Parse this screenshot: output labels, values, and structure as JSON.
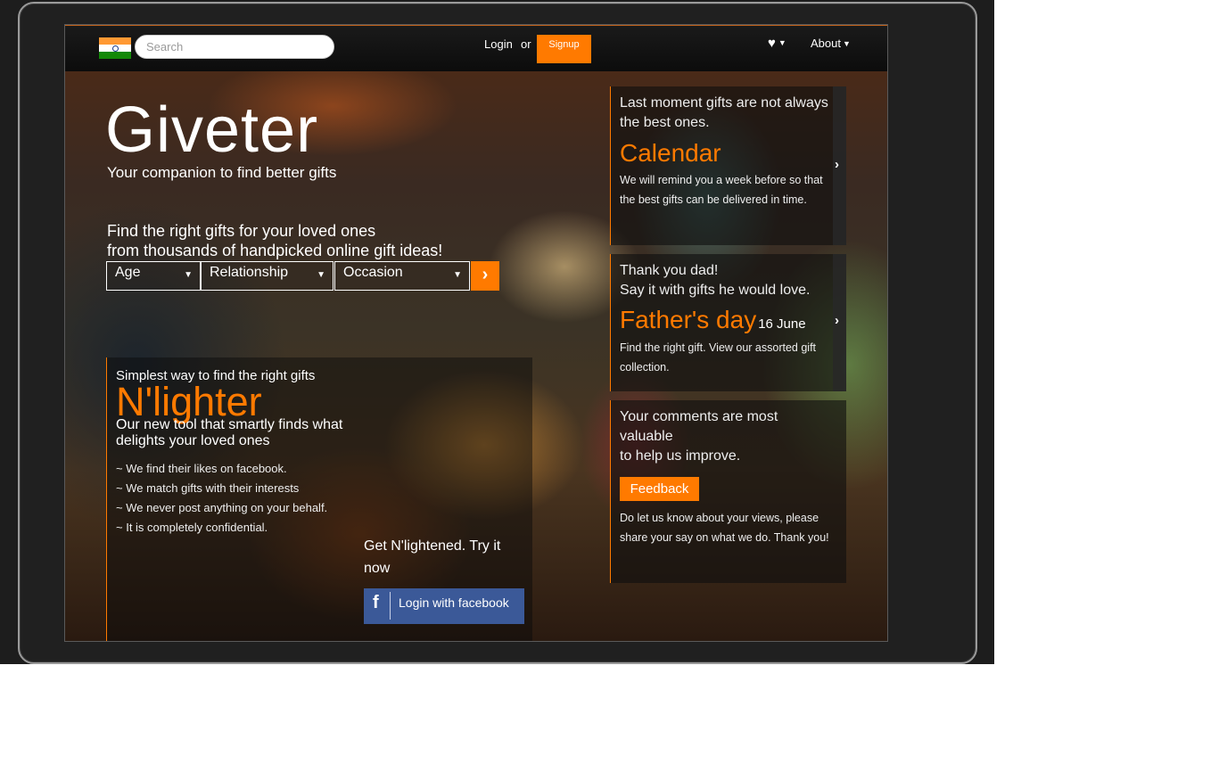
{
  "search": {
    "placeholder": "Search"
  },
  "nav": {
    "login_label": "Login",
    "or_label": "or",
    "signup_label": "Signup",
    "about_label": "About",
    "wishlist_icon": "heart-icon",
    "flag_icon": "india-flag-icon"
  },
  "hero": {
    "brand": "Giveter",
    "tagline": "Your companion to find better gifts",
    "find_line1": "Find the right gifts for your loved ones",
    "find_line2": "from thousands of handpicked online gift ideas!",
    "filters": [
      {
        "label": "Age"
      },
      {
        "label": "Relationship"
      },
      {
        "label": "Occasion"
      }
    ]
  },
  "nlighter": {
    "top": "Simplest way to find the right gifts",
    "title": "N'lighter",
    "desc": "Our new tool that smartly finds what delights your loved ones",
    "points": [
      "~ We find their likes on facebook.",
      "~ We match gifts with their interests",
      "~ We never post anything on your behalf.",
      "~ It is completely confidential."
    ],
    "cta": "Get N'lightened. Try it now",
    "fb_button": "Login with facebook"
  },
  "cards": {
    "calendar": {
      "pre": "Last moment gifts are not always the best ones.",
      "title": "Calendar",
      "body": "We will remind you a week before so that the best gifts can be delivered in time."
    },
    "fathers_day": {
      "pre1": "Thank you dad!",
      "pre2": "Say it with gifts he would love.",
      "title": "Father's day",
      "date": "16 June",
      "body": "Find the right gift. View our assorted gift collection."
    },
    "feedback": {
      "pre1": "Your comments are most valuable",
      "pre2": "to help us improve.",
      "button": "Feedback",
      "body": "Do let us know about your views, please share your say on what we do. Thank you!"
    }
  },
  "colors": {
    "accent": "#ff7a00",
    "facebook": "#3b5998",
    "nav_bg": "#111111"
  }
}
